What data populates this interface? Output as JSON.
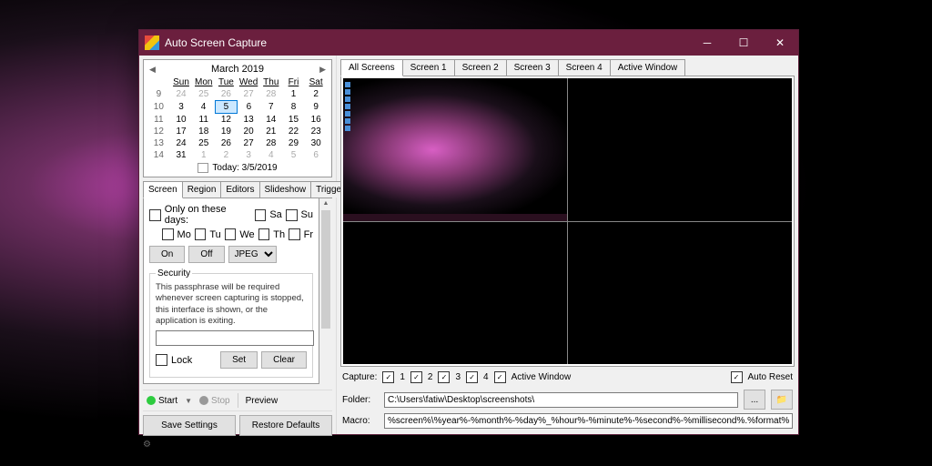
{
  "title": "Auto Screen Capture",
  "calendar": {
    "month": "March 2019",
    "headers": [
      "",
      "Sun",
      "Mon",
      "Tue",
      "Wed",
      "Thu",
      "Fri",
      "Sat"
    ],
    "today_footer": "Today: 3/5/2019",
    "weeks": [
      {
        "wk": "9",
        "d": [
          "24",
          "25",
          "26",
          "27",
          "28",
          "1",
          "2"
        ],
        "dim": [
          0,
          1,
          2,
          3,
          4
        ]
      },
      {
        "wk": "10",
        "d": [
          "3",
          "4",
          "5",
          "6",
          "7",
          "8",
          "9"
        ],
        "today": 2
      },
      {
        "wk": "11",
        "d": [
          "10",
          "11",
          "12",
          "13",
          "14",
          "15",
          "16"
        ]
      },
      {
        "wk": "12",
        "d": [
          "17",
          "18",
          "19",
          "20",
          "21",
          "22",
          "23"
        ]
      },
      {
        "wk": "13",
        "d": [
          "24",
          "25",
          "26",
          "27",
          "28",
          "29",
          "30"
        ]
      },
      {
        "wk": "14",
        "d": [
          "31",
          "1",
          "2",
          "3",
          "4",
          "5",
          "6"
        ],
        "dim": [
          1,
          2,
          3,
          4,
          5,
          6
        ]
      }
    ]
  },
  "left_tabs": [
    "Screen",
    "Region",
    "Editors",
    "Slideshow",
    "Triggers"
  ],
  "only_days": "Only on these days:",
  "days_short": {
    "sa": "Sa",
    "su": "Su",
    "mo": "Mo",
    "tu": "Tu",
    "we": "We",
    "th": "Th",
    "fr": "Fr"
  },
  "on_btn": "On",
  "off_btn": "Off",
  "format": "JPEG",
  "security": {
    "legend": "Security",
    "text": "This passphrase will be required whenever screen capturing is stopped, this interface is shown, or the application is exiting.",
    "lock": "Lock",
    "set": "Set",
    "clear": "Clear"
  },
  "start": "Start",
  "stop": "Stop",
  "preview": "Preview",
  "save_settings": "Save Settings",
  "restore_defaults": "Restore Defaults",
  "options": "Options",
  "right_tabs": [
    "All Screens",
    "Screen 1",
    "Screen 2",
    "Screen 3",
    "Screen 4",
    "Active Window"
  ],
  "capture": "Capture:",
  "cap_items": {
    "c1": "1",
    "c2": "2",
    "c3": "3",
    "c4": "4",
    "aw": "Active Window"
  },
  "auto_reset": "Auto Reset",
  "folder_label": "Folder:",
  "folder_value": "C:\\Users\\fatiw\\Desktop\\screenshots\\",
  "macro_label": "Macro:",
  "macro_value": "%screen%\\%year%-%month%-%day%_%hour%-%minute%-%second%-%millisecond%.%format%",
  "browse": "..."
}
